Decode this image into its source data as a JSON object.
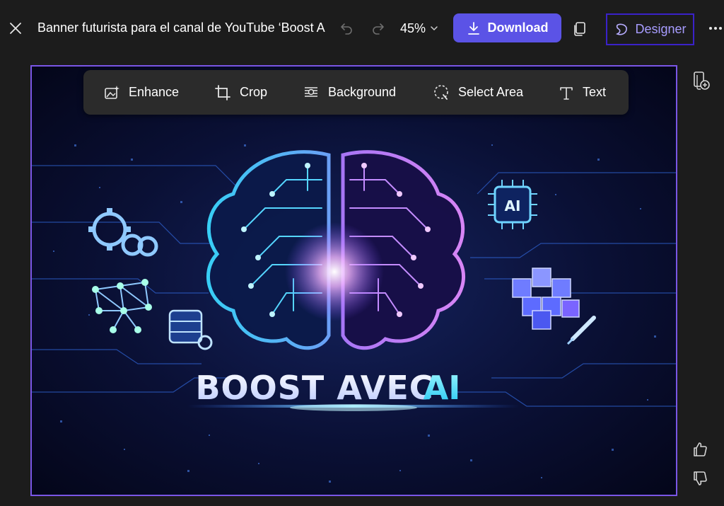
{
  "header": {
    "title": "Banner futurista para el canal de YouTube ‘Boost A",
    "zoom": "45%",
    "download_label": "Download",
    "designer_label": "Designer"
  },
  "toolbar": {
    "enhance": "Enhance",
    "crop": "Crop",
    "background": "Background",
    "select_area": "Select Area",
    "text": "Text"
  },
  "image": {
    "banner_text_main": "BOOST AVEC",
    "banner_text_ai": "AI",
    "chip_label": "AI"
  },
  "icons": {
    "close": "close-icon",
    "undo": "undo-icon",
    "redo": "redo-icon",
    "chevron": "chevron-down-icon",
    "download": "download-arrow-icon",
    "copy": "copy-icon",
    "designer": "designer-logo-icon",
    "more": "more-horizontal-icon",
    "add_page": "add-page-icon",
    "thumbs_up": "thumbs-up-icon",
    "thumbs_down": "thumbs-down-icon"
  },
  "colors": {
    "accent": "#5b53e6",
    "designer_text": "#a79cff",
    "frame_border": "#7a56e6",
    "background": "#1c1c1c"
  }
}
